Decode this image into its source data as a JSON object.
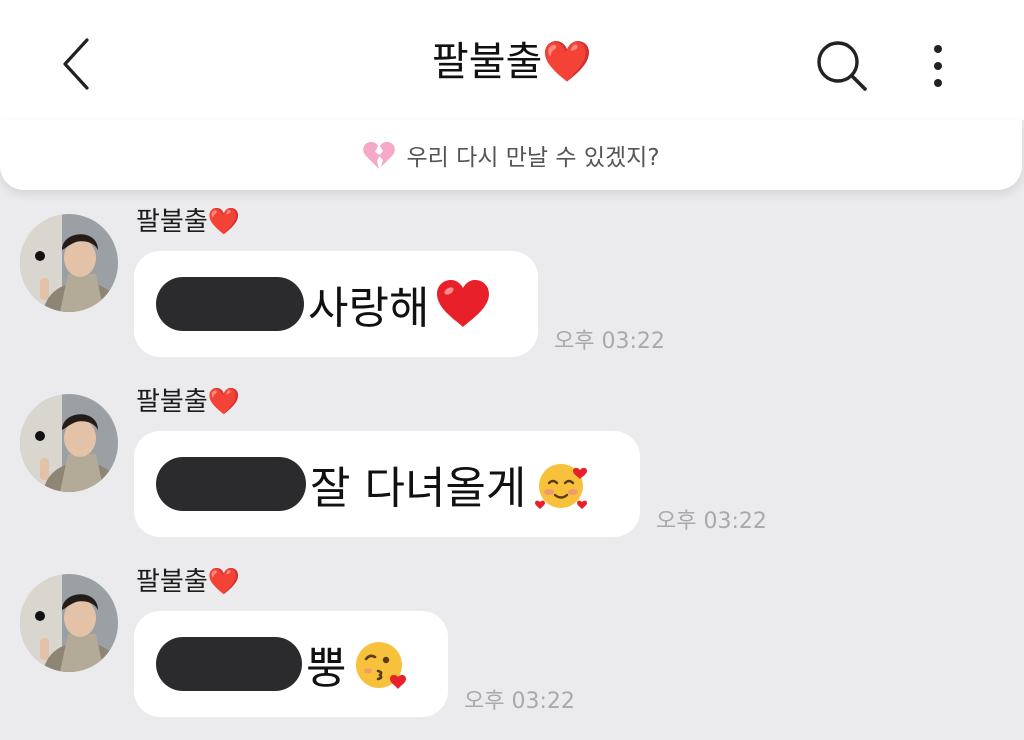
{
  "header": {
    "title": "팔불출❤️",
    "icons": {
      "back": "chevron-left-icon",
      "search": "search-icon",
      "more": "more-vertical-icon"
    }
  },
  "notice": {
    "icon": "broken-heart-icon",
    "text": "우리 다시 만날 수 있겠지?"
  },
  "messages": [
    {
      "sender": "팔불출❤️",
      "text": "사랑해",
      "emoji": "red-heart",
      "time": "오후 03:22"
    },
    {
      "sender": "팔불출❤️",
      "text": "잘 다녀올게",
      "emoji": "smiling-face-with-hearts",
      "time": "오후 03:22"
    },
    {
      "sender": "팔불출❤️",
      "text": "뿡",
      "emoji": "face-blowing-kiss",
      "time": "오후 03:22"
    }
  ],
  "colors": {
    "background": "#ebebed",
    "bubble": "#ffffff",
    "redaction": "#2b2b2d",
    "timestamp": "#a9a9ab",
    "heart": "#e8202a",
    "broken_heart": "#f4a9c6"
  }
}
